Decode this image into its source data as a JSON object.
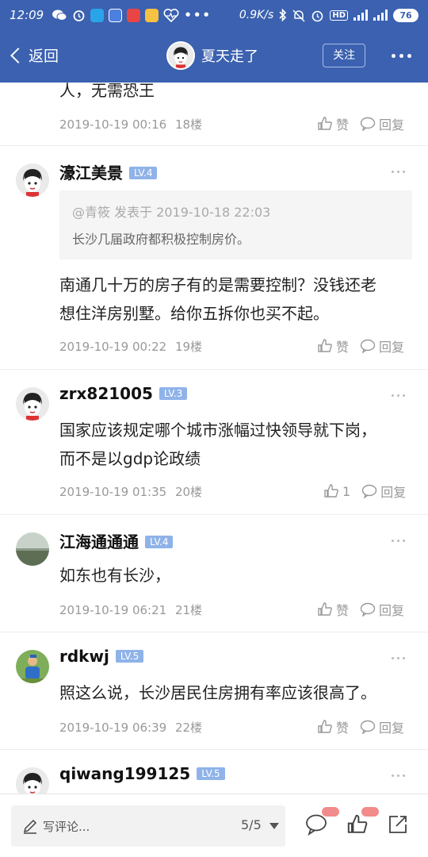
{
  "status_bar": {
    "time": "12:09",
    "speed": "0.9K/s",
    "battery": "76",
    "net1": "4G",
    "net2": "3G"
  },
  "nav": {
    "back_label": "返回",
    "title": "夏天走了",
    "follow_label": "关注"
  },
  "partial_comment": {
    "text": "人，无需恐王",
    "date": "2019-10-19 00:16",
    "floor": "18楼",
    "like_label": "赞",
    "reply_label": "回复"
  },
  "comments": [
    {
      "username": "濠江美景",
      "level": "LV.4",
      "quote": {
        "header": "@青筱 发表于 2019-10-18 22:03",
        "body": "长沙几届政府都积极控制房价。"
      },
      "lines": [
        "南通几十万的房子有的是需要控制？没钱还老",
        "想住洋房别墅。给你五拆你也买不起。"
      ],
      "date": "2019-10-19 00:22",
      "floor": "19楼",
      "like_label": "赞",
      "reply_label": "回复"
    },
    {
      "username": "zrx821005",
      "level": "LV.3",
      "lines": [
        "国家应该规定哪个城市涨幅过快领导就下岗，",
        "而不是以gdp论政绩"
      ],
      "date": "2019-10-19 01:35",
      "floor": "20楼",
      "like_label": "1",
      "reply_label": "回复"
    },
    {
      "username": "江海通通通",
      "level": "LV.4",
      "lines": [
        "如东也有长沙，"
      ],
      "date": "2019-10-19 06:21",
      "floor": "21楼",
      "like_label": "赞",
      "reply_label": "回复"
    },
    {
      "username": "rdkwj",
      "level": "LV.5",
      "lines": [
        "照这么说，长沙居民住房拥有率应该很高了。"
      ],
      "date": "2019-10-19 06:39",
      "floor": "22楼",
      "like_label": "赞",
      "reply_label": "回复"
    },
    {
      "username": "qiwang199125",
      "level": "LV.5"
    }
  ],
  "bottom_bar": {
    "placeholder": "写评论...",
    "page": "5/5"
  },
  "colors": {
    "brand": "#3b61b0",
    "level_badge": "#8fb3e9",
    "meta_text": "#999999"
  }
}
